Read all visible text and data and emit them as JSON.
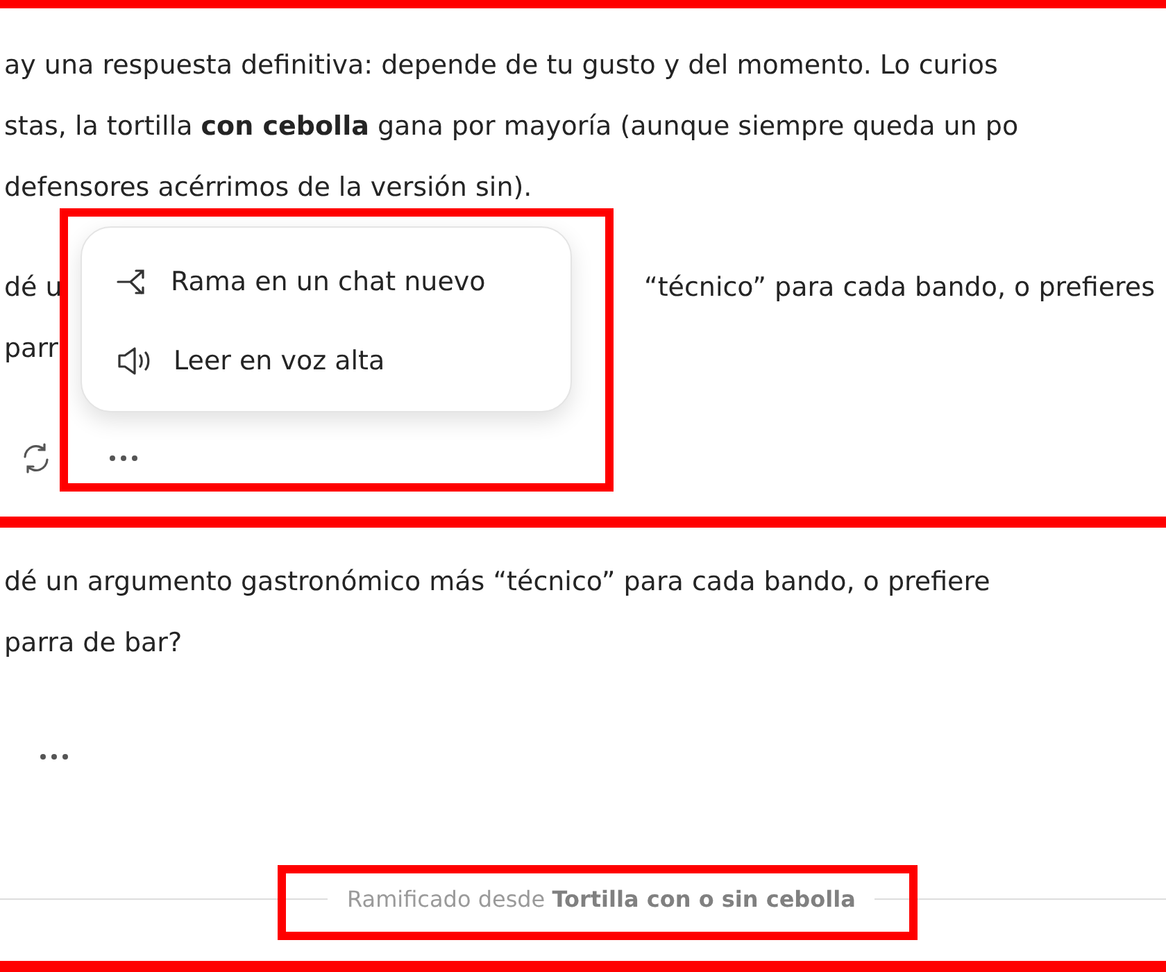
{
  "top_panel": {
    "lines": [
      [
        "ay una respuesta definitiva: depende de tu gusto y del momento. Lo curios"
      ],
      [
        "stas, la tortilla **con cebolla** gana por mayoría (aunque siempre queda un po"
      ],
      [
        "defensores acérrimos de la versión sin)."
      ],
      [
        "dé u",
        "“técnico” para cada bando, o prefieres"
      ],
      [
        "parr"
      ]
    ],
    "menu": {
      "items": [
        {
          "label": "Rama en un chat nuevo",
          "kind": "branch"
        },
        {
          "label": "Leer en voz alta",
          "kind": "speaker"
        }
      ]
    }
  },
  "bottom_panel": {
    "lines": [
      [
        "dé un argumento gastronómico más “técnico” para cada bando, o prefiere"
      ],
      [
        "parra de bar?"
      ]
    ],
    "branch_note": "Ramificado desde **Tortilla con o sin cebolla**"
  }
}
